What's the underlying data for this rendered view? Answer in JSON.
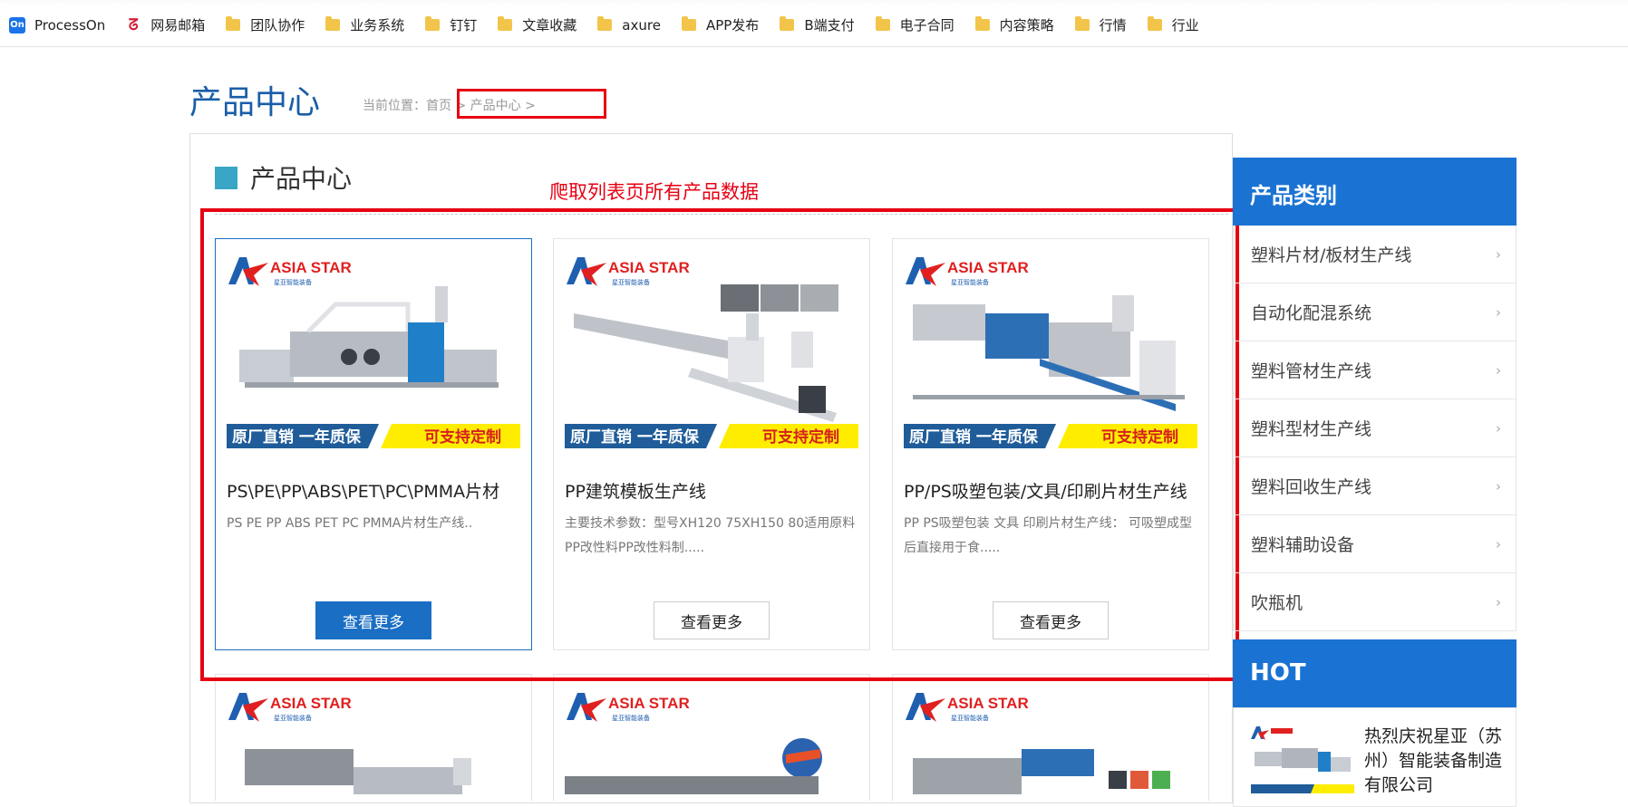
{
  "bookmarks": [
    {
      "label": "ProcessOn",
      "icon": "processon-icon"
    },
    {
      "label": "网易邮箱",
      "icon": "netease-mail-icon"
    },
    {
      "label": "团队协作",
      "icon": "folder-icon"
    },
    {
      "label": "业务系统",
      "icon": "folder-icon"
    },
    {
      "label": "钉钉",
      "icon": "folder-icon"
    },
    {
      "label": "文章收藏",
      "icon": "folder-icon"
    },
    {
      "label": "axure",
      "icon": "folder-icon"
    },
    {
      "label": "APP发布",
      "icon": "folder-icon"
    },
    {
      "label": "B端支付",
      "icon": "folder-icon"
    },
    {
      "label": "电子合同",
      "icon": "folder-icon"
    },
    {
      "label": "内容策略",
      "icon": "folder-icon"
    },
    {
      "label": "行情",
      "icon": "folder-icon"
    },
    {
      "label": "行业",
      "icon": "folder-icon"
    }
  ],
  "page": {
    "title": "产品中心",
    "breadcrumb": "当前位置：首页 > 产品中心 >",
    "section_title": "产品中心",
    "annotation": "爬取列表页所有产品数据"
  },
  "brand": {
    "logo_text": "ASIA STAR",
    "logo_sub": "星亚智能装备",
    "banner_left": "原厂直销  一年质保",
    "banner_right": "可支持定制"
  },
  "products": [
    {
      "name": "PS\\PE\\PP\\ABS\\PET\\PC\\PMMA片材",
      "desc": "PS PE PP ABS PET PC PMMA片材生产线..",
      "button": "查看更多"
    },
    {
      "name": "PP建筑模板生产线",
      "desc": "主要技术参数：型号XH120 75XH150 80适用原料PP改性料PP改性料制.....",
      "button": "查看更多"
    },
    {
      "name": "PP/PS吸塑包装/文具/印刷片材生产线",
      "desc": "PP PS吸塑包装 文具 印刷片材生产线： 可吸塑成型后直接用于食.....",
      "button": "查看更多"
    }
  ],
  "sidebar": {
    "title": "产品类别",
    "items": [
      "塑料片材/板材生产线",
      "自动化配混系统",
      "塑料管材生产线",
      "塑料型材生产线",
      "塑料回收生产线",
      "塑料辅助设备",
      "吹瓶机"
    ],
    "hot_title": "HOT",
    "hot_item": "热烈庆祝星亚（苏州）智能装备制造有限公司"
  },
  "colors": {
    "accent": "#1a73d2",
    "annotation": "#e60012",
    "banner_blue": "#1f5c99",
    "banner_yellow": "#ffed00"
  }
}
